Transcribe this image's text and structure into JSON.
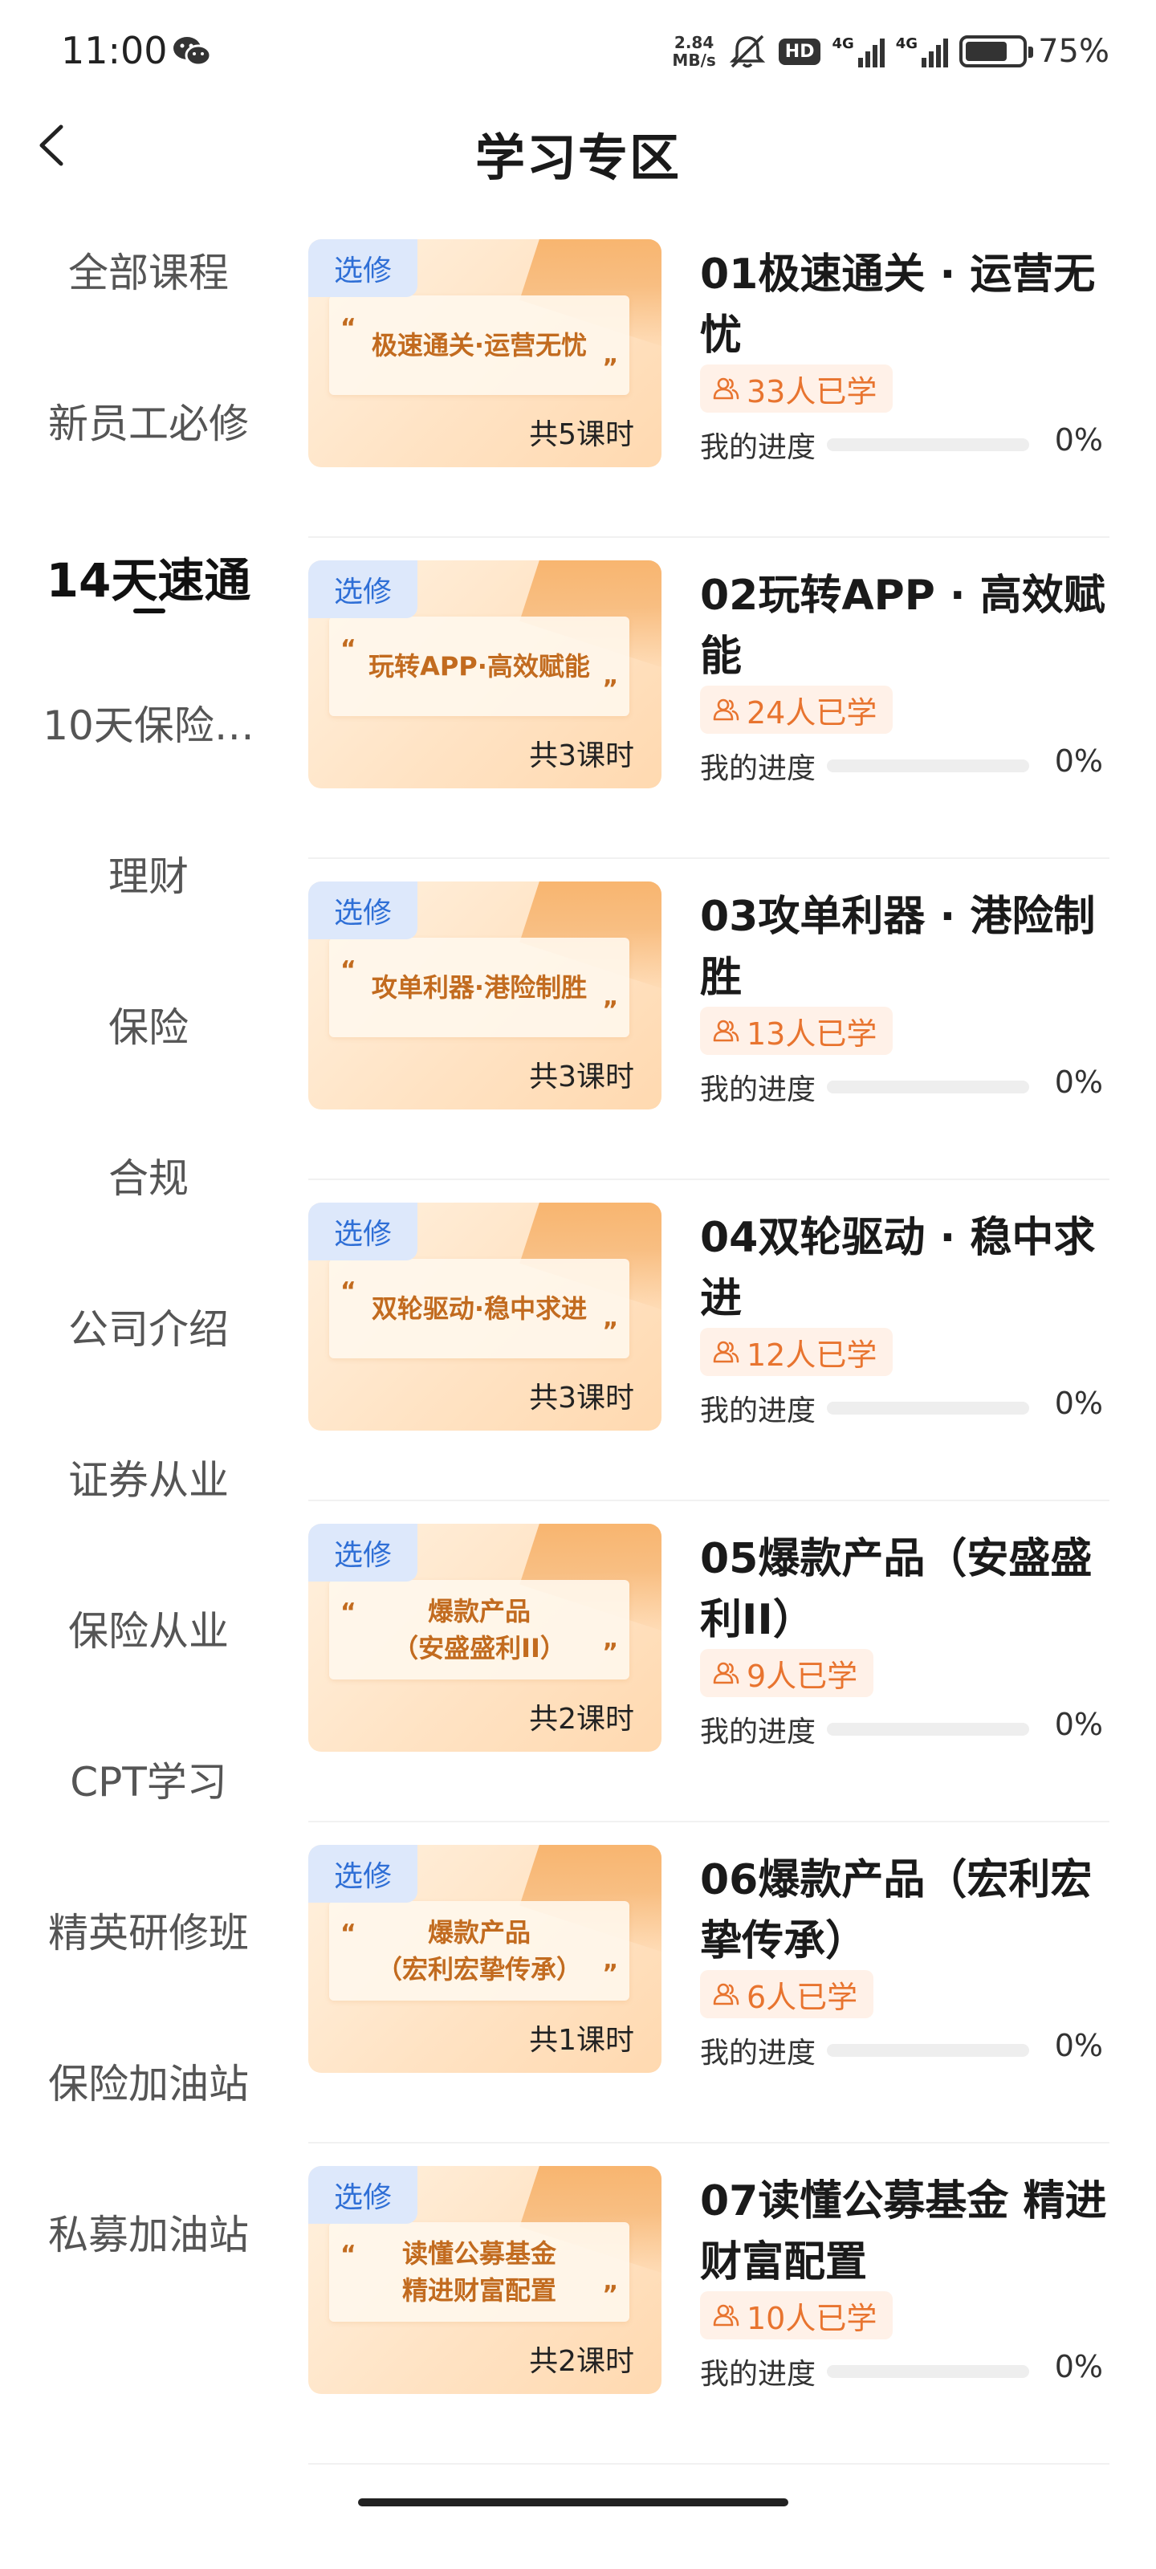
{
  "status_bar": {
    "time": "11:00",
    "net_speed_value": "2.84",
    "net_speed_unit": "MB/s",
    "hd": "HD",
    "signal_1": "4G",
    "signal_2": "4G",
    "battery_percent": "75%",
    "battery_level": 0.75
  },
  "header": {
    "title": "学习专区"
  },
  "sidebar": {
    "items": [
      {
        "label": "全部课程"
      },
      {
        "label": "新员工必修"
      },
      {
        "label": "14天速通"
      },
      {
        "label": "10天保险…"
      },
      {
        "label": "理财"
      },
      {
        "label": "保险"
      },
      {
        "label": "合规"
      },
      {
        "label": "公司介绍"
      },
      {
        "label": "证券从业"
      },
      {
        "label": "保险从业"
      },
      {
        "label": "CPT学习"
      },
      {
        "label": "精英研修班"
      },
      {
        "label": "保险加油站"
      },
      {
        "label": "私募加油站"
      }
    ],
    "active_index": 2
  },
  "progress_label": "我的进度",
  "elective_label": "选修",
  "courses": [
    {
      "thumb_line1": "极速通关·运营无忧",
      "thumb_line2": "",
      "lessons": "共5课时",
      "title": "01极速通关 · 运营无忧",
      "learners": "33人已学",
      "progress_text": "0%",
      "progress": 0
    },
    {
      "thumb_line1": "玩转APP·高效赋能",
      "thumb_line2": "",
      "lessons": "共3课时",
      "title": "02玩转APP · 高效赋能",
      "learners": "24人已学",
      "progress_text": "0%",
      "progress": 0
    },
    {
      "thumb_line1": "攻单利器·港险制胜",
      "thumb_line2": "",
      "lessons": "共3课时",
      "title": "03攻单利器 · 港险制胜",
      "learners": "13人已学",
      "progress_text": "0%",
      "progress": 0
    },
    {
      "thumb_line1": "双轮驱动·稳中求进",
      "thumb_line2": "",
      "lessons": "共3课时",
      "title": "04双轮驱动 · 稳中求进",
      "learners": "12人已学",
      "progress_text": "0%",
      "progress": 0
    },
    {
      "thumb_line1": "爆款产品",
      "thumb_line2": "（安盛盛利II）",
      "lessons": "共2课时",
      "title": "05爆款产品（安盛盛利II）",
      "learners": "9人已学",
      "progress_text": "0%",
      "progress": 0
    },
    {
      "thumb_line1": "爆款产品",
      "thumb_line2": "（宏利宏挚传承）",
      "lessons": "共1课时",
      "title": "06爆款产品（宏利宏挚传承）",
      "learners": "6人已学",
      "progress_text": "0%",
      "progress": 0
    },
    {
      "thumb_line1": "读懂公募基金",
      "thumb_line2": "精进财富配置",
      "lessons": "共2课时",
      "title": "07读懂公募基金 精进财富配置",
      "learners": "10人已学",
      "progress_text": "0%",
      "progress": 0
    }
  ],
  "colors": {
    "accent": "#e8742f",
    "elective_bg": "#dde8fb",
    "elective_text": "#2f6fd6"
  }
}
